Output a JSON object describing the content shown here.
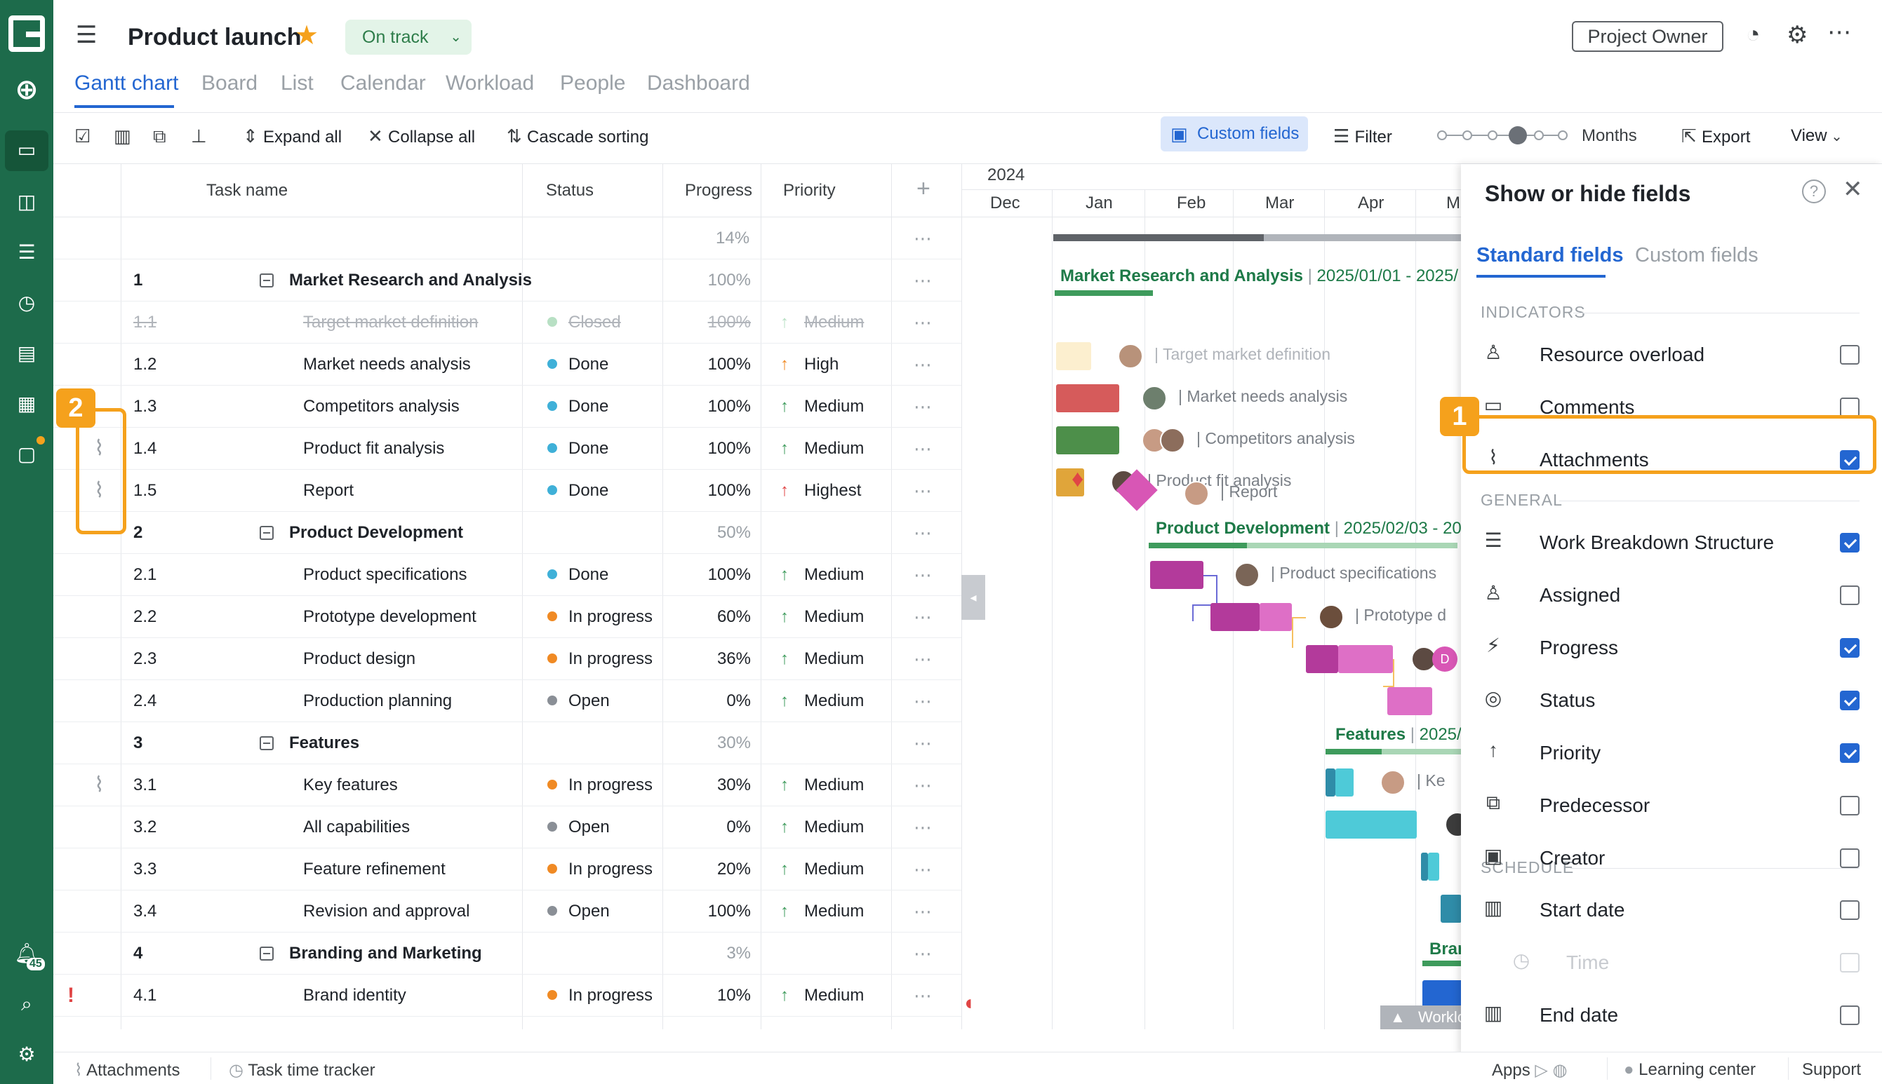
{
  "header": {
    "title": "Product launch",
    "status": "On track",
    "owner_button": "Project Owner"
  },
  "tabs": [
    "Gantt chart",
    "Board",
    "List",
    "Calendar",
    "Workload",
    "People",
    "Dashboard"
  ],
  "toolbar": {
    "expand_all": "Expand all",
    "collapse_all": "Collapse all",
    "cascade_sorting": "Cascade sorting",
    "custom_fields": "Custom fields",
    "filter": "Filter",
    "zoom": "Months",
    "export": "Export",
    "view": "View"
  },
  "columns": {
    "task_name": "Task name",
    "status": "Status",
    "progress": "Progress",
    "priority": "Priority"
  },
  "summary_progress": "14%",
  "rows": [
    {
      "wbs": "1",
      "name": "Market Research and Analysis",
      "group": true,
      "status": "",
      "progress": "100%",
      "priority": ""
    },
    {
      "wbs": "1.1",
      "name": "Target market definition",
      "status": "Closed",
      "progress": "100%",
      "priority": "Medium",
      "closed": true
    },
    {
      "wbs": "1.2",
      "name": "Market needs analysis",
      "status": "Done",
      "progress": "100%",
      "priority": "High"
    },
    {
      "wbs": "1.3",
      "name": "Competitors analysis",
      "status": "Done",
      "progress": "100%",
      "priority": "Medium"
    },
    {
      "wbs": "1.4",
      "name": "Product fit analysis",
      "status": "Done",
      "progress": "100%",
      "priority": "Medium",
      "attach": true
    },
    {
      "wbs": "1.5",
      "name": "Report",
      "status": "Done",
      "progress": "100%",
      "priority": "Highest",
      "attach": true
    },
    {
      "wbs": "2",
      "name": "Product Development",
      "group": true,
      "status": "",
      "progress": "50%",
      "priority": ""
    },
    {
      "wbs": "2.1",
      "name": "Product specifications",
      "status": "Done",
      "progress": "100%",
      "priority": "Medium"
    },
    {
      "wbs": "2.2",
      "name": "Prototype development",
      "status": "In progress",
      "progress": "60%",
      "priority": "Medium"
    },
    {
      "wbs": "2.3",
      "name": "Product design",
      "status": "In progress",
      "progress": "36%",
      "priority": "Medium"
    },
    {
      "wbs": "2.4",
      "name": "Production planning",
      "status": "Open",
      "progress": "0%",
      "priority": "Medium"
    },
    {
      "wbs": "3",
      "name": "Features",
      "group": true,
      "status": "",
      "progress": "30%",
      "priority": ""
    },
    {
      "wbs": "3.1",
      "name": "Key features",
      "status": "In progress",
      "progress": "30%",
      "priority": "Medium",
      "attach": true
    },
    {
      "wbs": "3.2",
      "name": "All capabilities",
      "status": "Open",
      "progress": "0%",
      "priority": "Medium"
    },
    {
      "wbs": "3.3",
      "name": "Feature refinement",
      "status": "In progress",
      "progress": "20%",
      "priority": "Medium"
    },
    {
      "wbs": "3.4",
      "name": "Revision and approval",
      "status": "Open",
      "progress": "100%",
      "priority": "Medium"
    },
    {
      "wbs": "4",
      "name": "Branding and Marketing",
      "group": true,
      "status": "",
      "progress": "3%",
      "priority": ""
    },
    {
      "wbs": "4.1",
      "name": "Brand identity",
      "status": "In progress",
      "progress": "10%",
      "priority": "Medium",
      "alert": "!"
    }
  ],
  "gantt": {
    "year": "2024",
    "months": [
      "Dec",
      "Jan",
      "Feb",
      "Mar",
      "Apr",
      "M"
    ],
    "groups": {
      "g1": {
        "name": "Market Research and Analysis",
        "dates": "2025/01/01 - 2025/"
      },
      "g2": {
        "name": "Product Development",
        "dates": "2025/02/03 - 20"
      },
      "g3": {
        "name": "Features",
        "dates": "2025/"
      },
      "g4": {
        "name": "Bran"
      }
    },
    "labels": {
      "t11": "Target market definition",
      "t12": "Market needs analysis",
      "t13": "Competitors analysis",
      "t14": "Product fit analysis",
      "t15": "Report",
      "t21": "Product specifications",
      "t22": "Prototype d",
      "t31": "Ke",
      "avatar_d": "D",
      "workload": "Worklo"
    }
  },
  "panel": {
    "title": "Show or hide fields",
    "tab_standard": "Standard fields",
    "tab_custom": "Custom fields",
    "sections": {
      "indicators": "INDICATORS",
      "general": "GENERAL",
      "schedule": "SCHEDULE"
    },
    "indicators": [
      {
        "label": "Resource overload",
        "checked": false
      },
      {
        "label": "Comments",
        "checked": false
      },
      {
        "label": "Attachments",
        "checked": true
      }
    ],
    "general": [
      {
        "label": "Work Breakdown Structure",
        "checked": true
      },
      {
        "label": "Assigned",
        "checked": false
      },
      {
        "label": "Progress",
        "checked": true
      },
      {
        "label": "Status",
        "checked": true
      },
      {
        "label": "Priority",
        "checked": true
      },
      {
        "label": "Predecessor",
        "checked": false
      },
      {
        "label": "Creator",
        "checked": false
      }
    ],
    "schedule": [
      {
        "label": "Start date",
        "checked": false
      },
      {
        "label": "Time",
        "checked": false,
        "disabled": true
      },
      {
        "label": "End date",
        "checked": false
      }
    ]
  },
  "callouts": {
    "one": "1",
    "two": "2"
  },
  "footer": {
    "attachments": "Attachments",
    "time_tracker": "Task time tracker",
    "apps": "Apps",
    "learning": "Learning center",
    "support": "Support"
  },
  "colors": {
    "sidebar": "#1d6b4b",
    "accent": "#2366d1",
    "highlight": "#f5a11c",
    "done": "#3fb0d8",
    "in_progress": "#f08a24",
    "open": "#8a8f96"
  },
  "notification_count": "45"
}
